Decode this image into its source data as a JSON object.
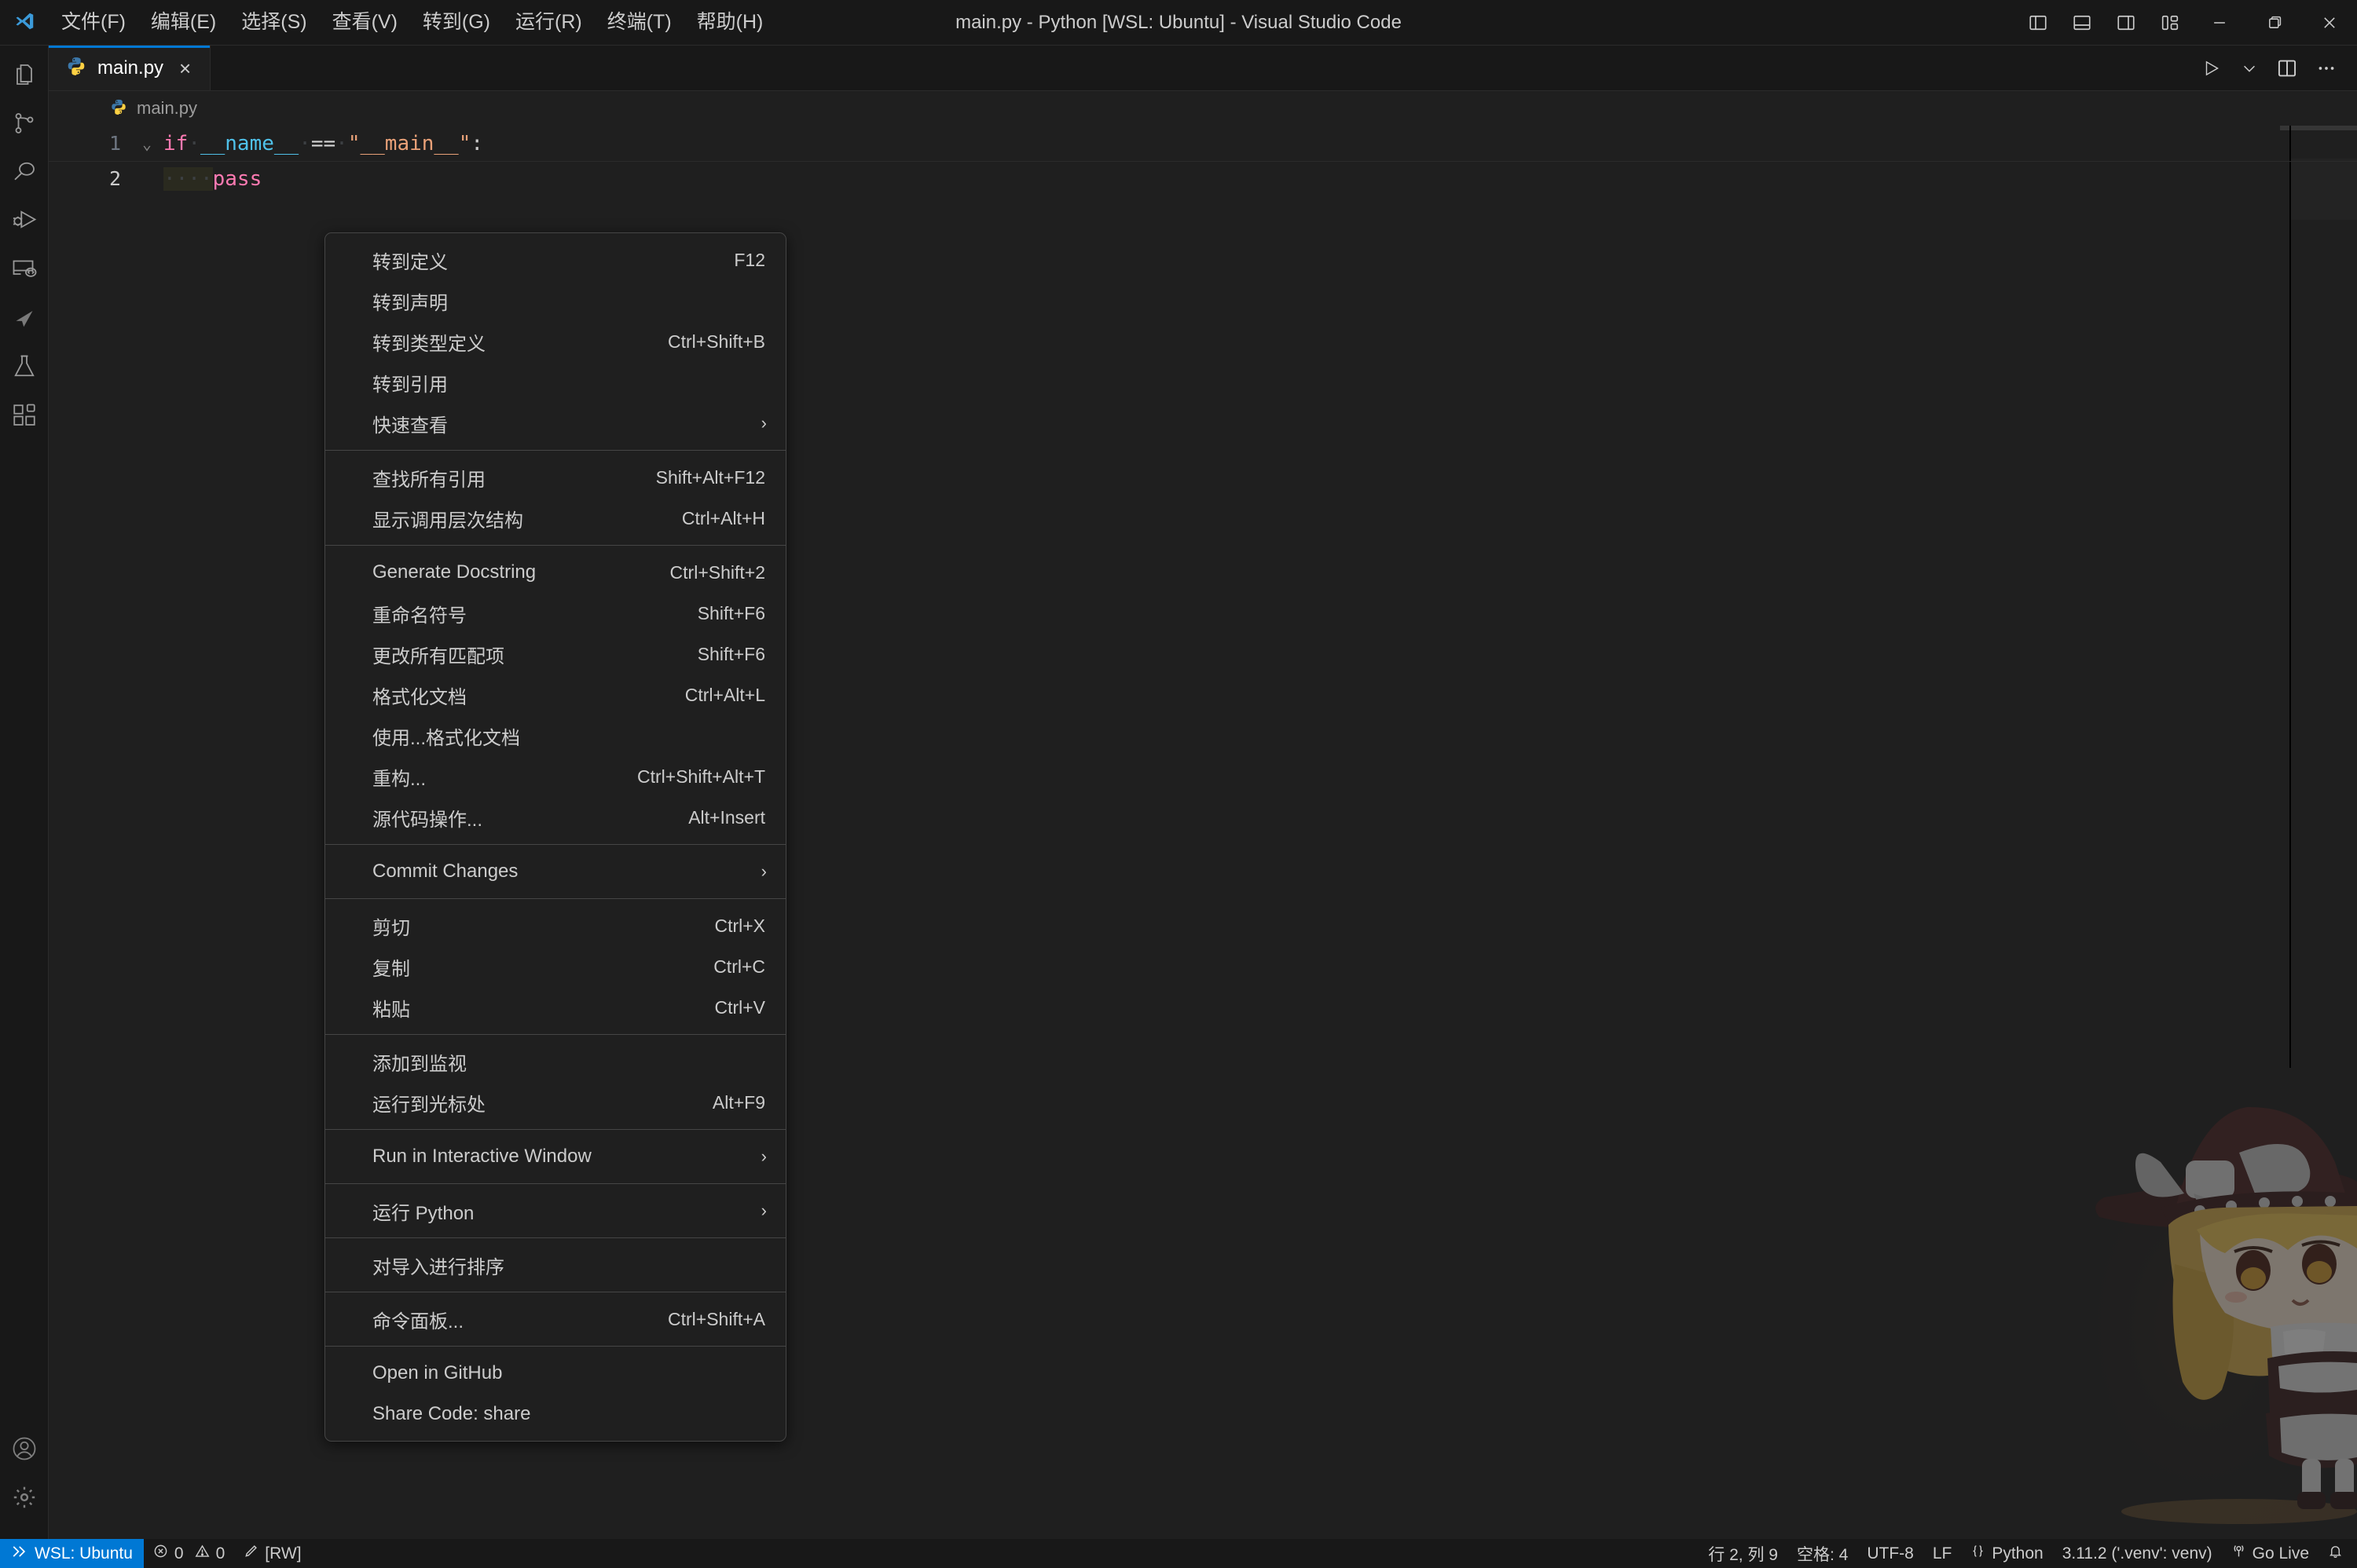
{
  "window": {
    "title": "main.py - Python [WSL: Ubuntu] - Visual Studio Code",
    "logo_name": "vscode-logo"
  },
  "menubar": {
    "items": [
      {
        "label": "文件(F)",
        "name": "menubar-item-file"
      },
      {
        "label": "编辑(E)",
        "name": "menubar-item-edit"
      },
      {
        "label": "选择(S)",
        "name": "menubar-item-selection"
      },
      {
        "label": "查看(V)",
        "name": "menubar-item-view"
      },
      {
        "label": "转到(G)",
        "name": "menubar-item-go"
      },
      {
        "label": "运行(R)",
        "name": "menubar-item-run"
      },
      {
        "label": "终端(T)",
        "name": "menubar-item-terminal"
      },
      {
        "label": "帮助(H)",
        "name": "menubar-item-help"
      }
    ]
  },
  "titlebar_controls": {
    "toggle_primary_sidebar": "toggle-primary-sidebar",
    "toggle_panel": "toggle-panel",
    "toggle_secondary_sidebar": "toggle-secondary-sidebar",
    "customize_layout": "customize-layout",
    "minimize": "minimize",
    "maximize": "maximize",
    "close": "close"
  },
  "activitybar": {
    "items": [
      {
        "name": "activity-explorer",
        "icon": "files-icon",
        "title": "资源管理器"
      },
      {
        "name": "activity-source-control",
        "icon": "source-control-icon",
        "title": "源代码管理"
      },
      {
        "name": "activity-search",
        "icon": "search-icon",
        "title": "搜索"
      },
      {
        "name": "activity-run-debug",
        "icon": "run-debug-icon",
        "title": "运行和调试"
      },
      {
        "name": "activity-remote-explorer",
        "icon": "remote-explorer-icon",
        "title": "远程资源管理器"
      },
      {
        "name": "activity-send",
        "icon": "send-cursor-icon",
        "title": "发送"
      },
      {
        "name": "activity-testing",
        "icon": "beaker-icon",
        "title": "测试"
      },
      {
        "name": "activity-extensions",
        "icon": "extensions-icon",
        "title": "扩展"
      }
    ],
    "bottom": [
      {
        "name": "activity-accounts",
        "icon": "account-icon",
        "title": "帐户"
      },
      {
        "name": "activity-settings",
        "icon": "gear-icon",
        "title": "管理"
      }
    ]
  },
  "editor": {
    "tab": {
      "label": "main.py",
      "icon": "python-file-icon",
      "close": "×"
    },
    "breadcrumb": {
      "icon": "python-file-icon",
      "label": "main.py"
    },
    "actions": {
      "run": "run-python-file",
      "run_chevron": "⌄",
      "split": "split-editor",
      "more": "···"
    },
    "lines": [
      {
        "number": "1",
        "fold": "⌄",
        "tokens": [
          {
            "text": "if",
            "cls": "t-kw"
          },
          {
            "text": "·",
            "cls": "ws-dot"
          },
          {
            "text": "__name__",
            "cls": "t-var"
          },
          {
            "text": "·",
            "cls": "ws-dot"
          },
          {
            "text": "==",
            "cls": "t-op"
          },
          {
            "text": "·",
            "cls": "ws-dot"
          },
          {
            "text": "\"__main__\"",
            "cls": "t-str"
          },
          {
            "text": ":",
            "cls": "t-punc"
          }
        ]
      },
      {
        "number": "2",
        "fold": "",
        "tokens": [
          {
            "text": "····",
            "cls": "ws-dot"
          },
          {
            "text": "pass",
            "cls": "t-kw"
          }
        ]
      }
    ]
  },
  "context_menu": {
    "groups": [
      {
        "items": [
          {
            "label": "转到定义",
            "key": "F12",
            "submenu": false,
            "name": "ctx-go-to-definition"
          },
          {
            "label": "转到声明",
            "key": "",
            "submenu": false,
            "name": "ctx-go-to-declaration"
          },
          {
            "label": "转到类型定义",
            "key": "Ctrl+Shift+B",
            "submenu": false,
            "name": "ctx-go-to-type-definition"
          },
          {
            "label": "转到引用",
            "key": "",
            "submenu": false,
            "name": "ctx-go-to-references"
          },
          {
            "label": "快速查看",
            "key": "",
            "submenu": true,
            "name": "ctx-peek"
          }
        ]
      },
      {
        "items": [
          {
            "label": "查找所有引用",
            "key": "Shift+Alt+F12",
            "submenu": false,
            "name": "ctx-find-all-references"
          },
          {
            "label": "显示调用层次结构",
            "key": "Ctrl+Alt+H",
            "submenu": false,
            "name": "ctx-show-call-hierarchy"
          }
        ]
      },
      {
        "items": [
          {
            "label": "Generate Docstring",
            "key": "Ctrl+Shift+2",
            "submenu": false,
            "name": "ctx-generate-docstring"
          },
          {
            "label": "重命名符号",
            "key": "Shift+F6",
            "submenu": false,
            "name": "ctx-rename-symbol"
          },
          {
            "label": "更改所有匹配项",
            "key": "Shift+F6",
            "submenu": false,
            "name": "ctx-change-all-occurrences"
          },
          {
            "label": "格式化文档",
            "key": "Ctrl+Alt+L",
            "submenu": false,
            "name": "ctx-format-document"
          },
          {
            "label": "使用...格式化文档",
            "key": "",
            "submenu": false,
            "name": "ctx-format-document-with"
          },
          {
            "label": "重构...",
            "key": "Ctrl+Shift+Alt+T",
            "submenu": false,
            "name": "ctx-refactor"
          },
          {
            "label": "源代码操作...",
            "key": "Alt+Insert",
            "submenu": false,
            "name": "ctx-source-action"
          }
        ]
      },
      {
        "items": [
          {
            "label": "Commit Changes",
            "key": "",
            "submenu": true,
            "name": "ctx-commit-changes"
          }
        ]
      },
      {
        "items": [
          {
            "label": "剪切",
            "key": "Ctrl+X",
            "submenu": false,
            "name": "ctx-cut"
          },
          {
            "label": "复制",
            "key": "Ctrl+C",
            "submenu": false,
            "name": "ctx-copy"
          },
          {
            "label": "粘贴",
            "key": "Ctrl+V",
            "submenu": false,
            "name": "ctx-paste"
          }
        ]
      },
      {
        "items": [
          {
            "label": "添加到监视",
            "key": "",
            "submenu": false,
            "name": "ctx-add-to-watch"
          },
          {
            "label": "运行到光标处",
            "key": "Alt+F9",
            "submenu": false,
            "name": "ctx-run-to-cursor"
          }
        ]
      },
      {
        "items": [
          {
            "label": "Run in Interactive Window",
            "key": "",
            "submenu": true,
            "name": "ctx-run-in-interactive-window"
          }
        ]
      },
      {
        "items": [
          {
            "label": "运行 Python",
            "key": "",
            "submenu": true,
            "name": "ctx-run-python"
          }
        ]
      },
      {
        "items": [
          {
            "label": "对导入进行排序",
            "key": "",
            "submenu": false,
            "name": "ctx-sort-imports"
          }
        ]
      },
      {
        "items": [
          {
            "label": "命令面板...",
            "key": "Ctrl+Shift+A",
            "submenu": false,
            "name": "ctx-command-palette"
          }
        ]
      },
      {
        "items": [
          {
            "label": "Open in GitHub",
            "key": "",
            "submenu": false,
            "name": "ctx-open-in-github"
          },
          {
            "label": "Share Code: share",
            "key": "",
            "submenu": false,
            "name": "ctx-share-code"
          }
        ]
      }
    ],
    "submenu_glyph": "›"
  },
  "statusbar": {
    "remote": {
      "label": "WSL: Ubuntu",
      "icon": "remote-indicator-icon"
    },
    "problems": {
      "errors": "0",
      "warnings": "0",
      "error_icon": "error-circle-icon",
      "warning_icon": "warning-triangle-icon"
    },
    "readonly": {
      "label": "[RW]",
      "icon": "pencil-icon"
    },
    "right": {
      "cursor_position": "行 2, 列 9",
      "indentation": "空格: 4",
      "encoding": "UTF-8",
      "eol": "LF",
      "language": "Python",
      "language_icon": "braces-icon",
      "interpreter": "3.11.2 ('.venv': venv)",
      "golive": "Go Live",
      "golive_icon": "broadcast-icon",
      "bell_icon": "bell-icon"
    }
  },
  "colors": {
    "accent": "#0078d4",
    "titlebar_bg": "#181818",
    "editor_bg": "#1f1f1f",
    "menu_bg": "#1f1f1f",
    "menu_border": "#454545",
    "text": "#cccccc"
  }
}
